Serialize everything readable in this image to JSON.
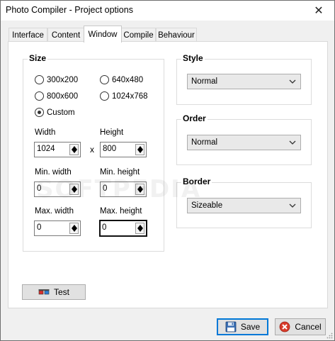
{
  "window": {
    "title": "Photo Compiler - Project options",
    "close_glyph": "✕"
  },
  "tabs": [
    {
      "label": "Interface",
      "active": false
    },
    {
      "label": "Content",
      "active": false
    },
    {
      "label": "Window",
      "active": true
    },
    {
      "label": "Compile",
      "active": false
    },
    {
      "label": "Behaviour",
      "active": false
    }
  ],
  "size": {
    "label": "Size",
    "radios": [
      {
        "label": "300x200",
        "checked": false
      },
      {
        "label": "640x480",
        "checked": false
      },
      {
        "label": "800x600",
        "checked": false
      },
      {
        "label": "1024x768",
        "checked": false
      },
      {
        "label": "Custom",
        "checked": true
      }
    ],
    "width_label": "Width",
    "width_value": "1024",
    "height_label": "Height",
    "height_value": "800",
    "x_sep": "x",
    "min_width_label": "Min. width",
    "min_width_value": "0",
    "min_height_label": "Min. height",
    "min_height_value": "0",
    "max_width_label": "Max. width",
    "max_width_value": "0",
    "max_height_label": "Max. height",
    "max_height_value": "0"
  },
  "style": {
    "label": "Style",
    "value": "Normal"
  },
  "order": {
    "label": "Order",
    "value": "Normal"
  },
  "border": {
    "label": "Border",
    "value": "Sizeable"
  },
  "buttons": {
    "test": "Test",
    "save": "Save",
    "cancel": "Cancel"
  },
  "watermark": "SOFTPEDIA",
  "icons": {
    "test": "3d-glasses-icon",
    "save": "floppy-disk-icon",
    "cancel": "cancel-icon"
  }
}
